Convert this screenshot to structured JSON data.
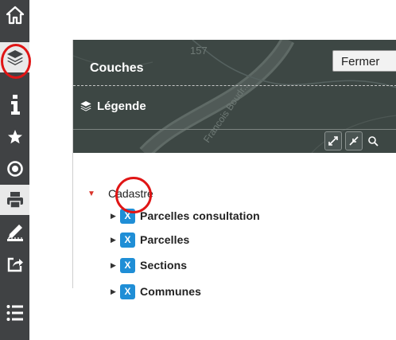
{
  "toolbar": {
    "items": [
      {
        "icon": "home-icon"
      },
      {
        "icon": "layers-icon",
        "active": true
      },
      {
        "icon": "info-icon"
      },
      {
        "icon": "star-icon"
      },
      {
        "icon": "target-icon"
      },
      {
        "icon": "print-icon",
        "active": true
      },
      {
        "icon": "ruler-icon"
      },
      {
        "icon": "share-icon"
      },
      {
        "icon": "list-icon"
      }
    ]
  },
  "panel": {
    "title": "Couches",
    "close_label": "Fermer",
    "legend_label": "Légende",
    "map_number": "157",
    "map_street": "Francois Boudr..."
  },
  "tree": {
    "group": "Cadastre",
    "layers": [
      {
        "name": "Parcelles consultation",
        "checked_symbol": "X"
      },
      {
        "name": "Parcelles",
        "checked_symbol": "X"
      },
      {
        "name": "Sections",
        "checked_symbol": "X"
      },
      {
        "name": "Communes",
        "checked_symbol": "X"
      }
    ]
  },
  "colors": {
    "toolbar_bg": "#404244",
    "panel_header_bg": "#3d4744",
    "checkbox_blue": "#1f8ed6",
    "highlight_red": "#e01515",
    "group_arrow_red": "#d9342b"
  }
}
